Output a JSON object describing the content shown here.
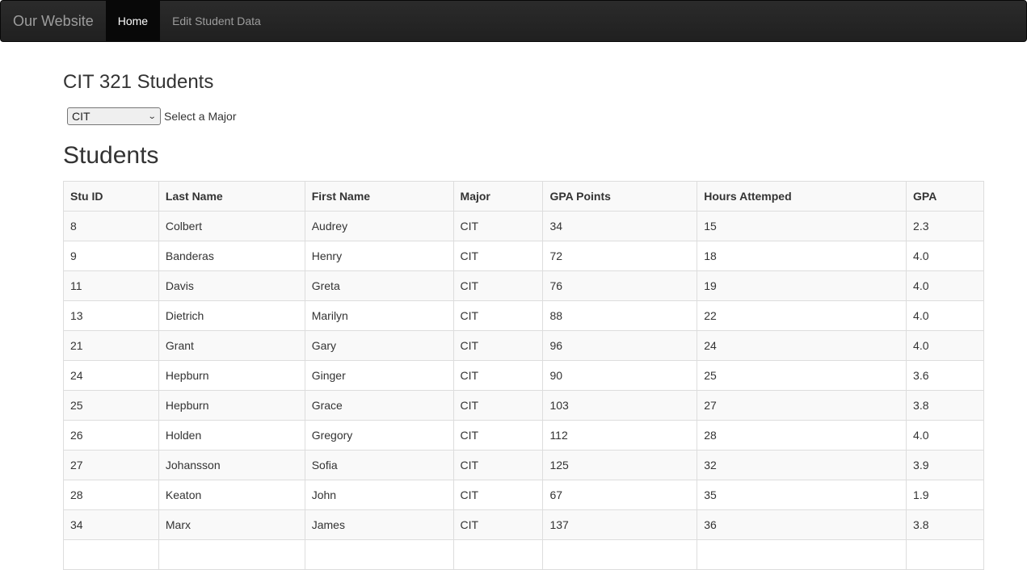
{
  "navbar": {
    "brand": "Our Website",
    "links": [
      {
        "label": "Home",
        "active": true
      },
      {
        "label": "Edit Student Data",
        "active": false
      }
    ]
  },
  "page": {
    "title": "CIT 321 Students",
    "major_select": {
      "value": "CIT",
      "label": "Select a Major"
    },
    "section_title": "Students"
  },
  "table": {
    "columns": [
      "Stu ID",
      "Last Name",
      "First Name",
      "Major",
      "GPA Points",
      "Hours Attemped",
      "GPA"
    ],
    "rows": [
      [
        "8",
        "Colbert",
        "Audrey",
        "CIT",
        "34",
        "15",
        "2.3"
      ],
      [
        "9",
        "Banderas",
        "Henry",
        "CIT",
        "72",
        "18",
        "4.0"
      ],
      [
        "11",
        "Davis",
        "Greta",
        "CIT",
        "76",
        "19",
        "4.0"
      ],
      [
        "13",
        "Dietrich",
        "Marilyn",
        "CIT",
        "88",
        "22",
        "4.0"
      ],
      [
        "21",
        "Grant",
        "Gary",
        "CIT",
        "96",
        "24",
        "4.0"
      ],
      [
        "24",
        "Hepburn",
        "Ginger",
        "CIT",
        "90",
        "25",
        "3.6"
      ],
      [
        "25",
        "Hepburn",
        "Grace",
        "CIT",
        "103",
        "27",
        "3.8"
      ],
      [
        "26",
        "Holden",
        "Gregory",
        "CIT",
        "112",
        "28",
        "4.0"
      ],
      [
        "27",
        "Johansson",
        "Sofia",
        "CIT",
        "125",
        "32",
        "3.9"
      ],
      [
        "28",
        "Keaton",
        "John",
        "CIT",
        "67",
        "35",
        "1.9"
      ],
      [
        "34",
        "Marx",
        "James",
        "CIT",
        "137",
        "36",
        "3.8"
      ],
      [
        "",
        "",
        "",
        "",
        "",
        "",
        ""
      ]
    ]
  }
}
